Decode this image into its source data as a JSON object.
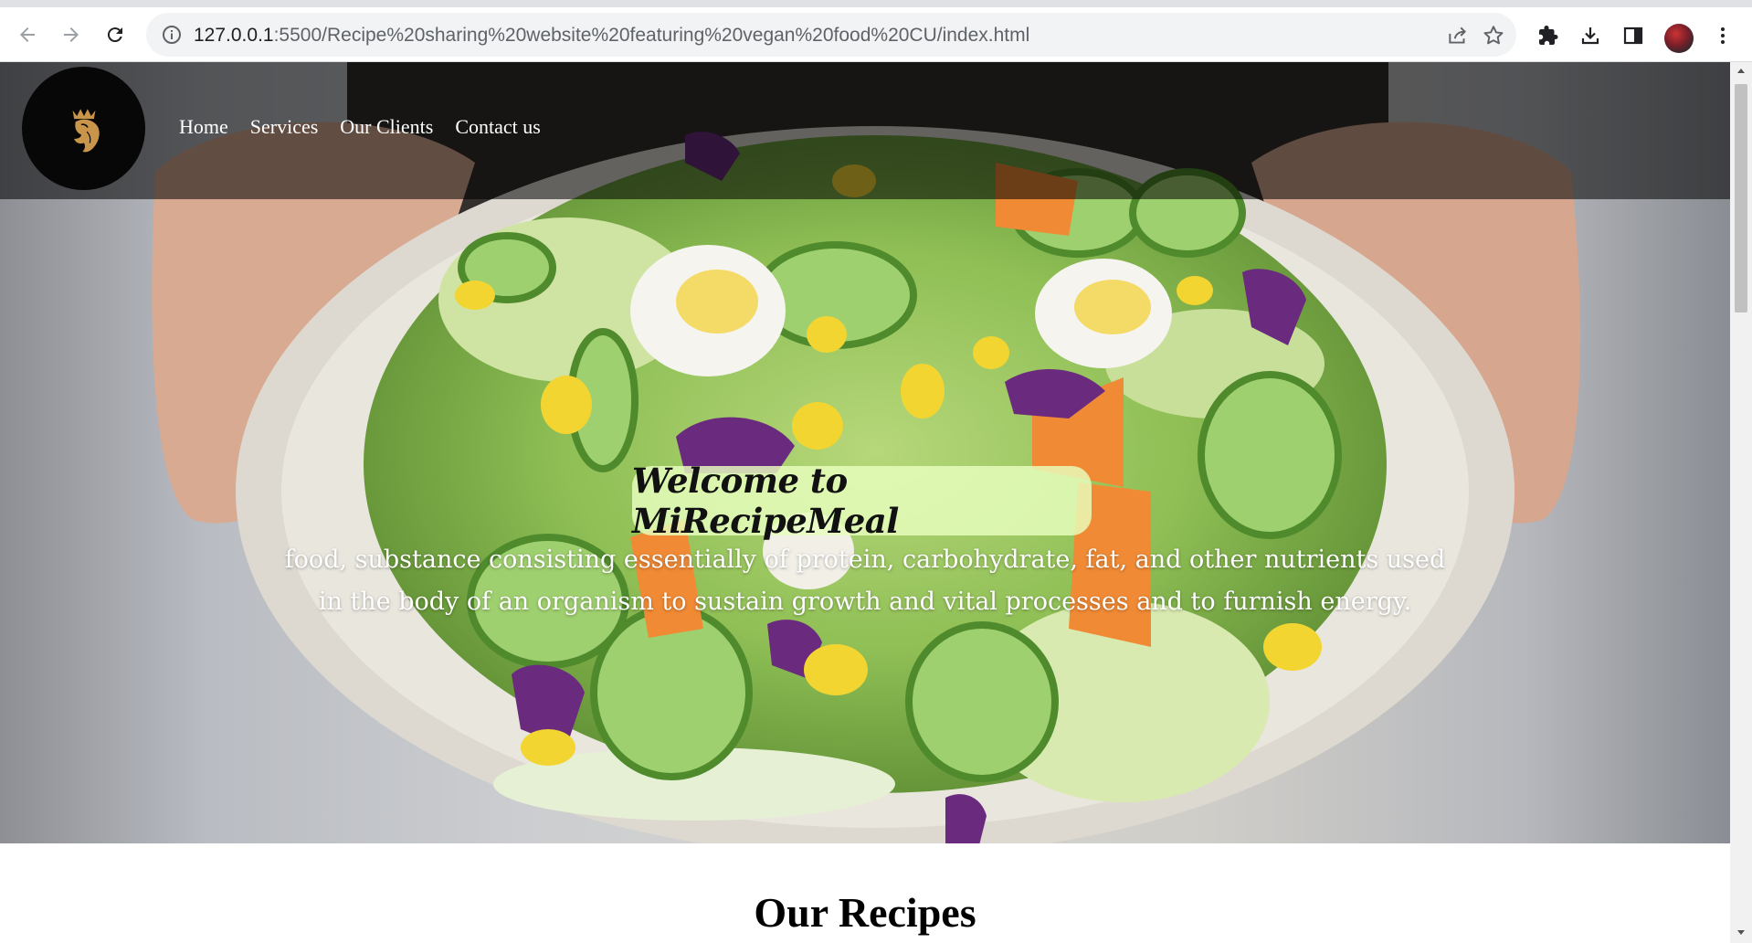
{
  "browser": {
    "url_host": "127.0.0.1",
    "url_path": ":5500/Recipe%20sharing%20website%20featuring%20vegan%20food%20CU/index.html"
  },
  "nav": {
    "items": [
      {
        "label": "Home"
      },
      {
        "label": "Services"
      },
      {
        "label": "Our Clients"
      },
      {
        "label": "Contact us"
      }
    ]
  },
  "hero": {
    "title": "Welcome to MiRecipeMeal",
    "tagline": "food, substance consisting essentially of protein, carbohydrate, fat, and other nutrients used in the body of an organism to sustain growth and vital processes and to furnish energy."
  },
  "recipes": {
    "heading": "Our Recipes"
  },
  "icons": {
    "back": "arrow-left-icon",
    "forward": "arrow-right-icon",
    "reload": "reload-icon",
    "site_info": "info-icon",
    "share": "share-icon",
    "bookmark": "star-icon",
    "extensions": "puzzle-icon",
    "downloads": "download-icon",
    "side_panel": "side-panel-icon",
    "menu": "more-vertical-icon",
    "logo": "lion-crown-logo"
  },
  "colors": {
    "navbar_overlay": "rgba(0,0,0,0.55)",
    "welcome_bg": "#e8ffbe",
    "logo_gold": "#c9954a"
  }
}
